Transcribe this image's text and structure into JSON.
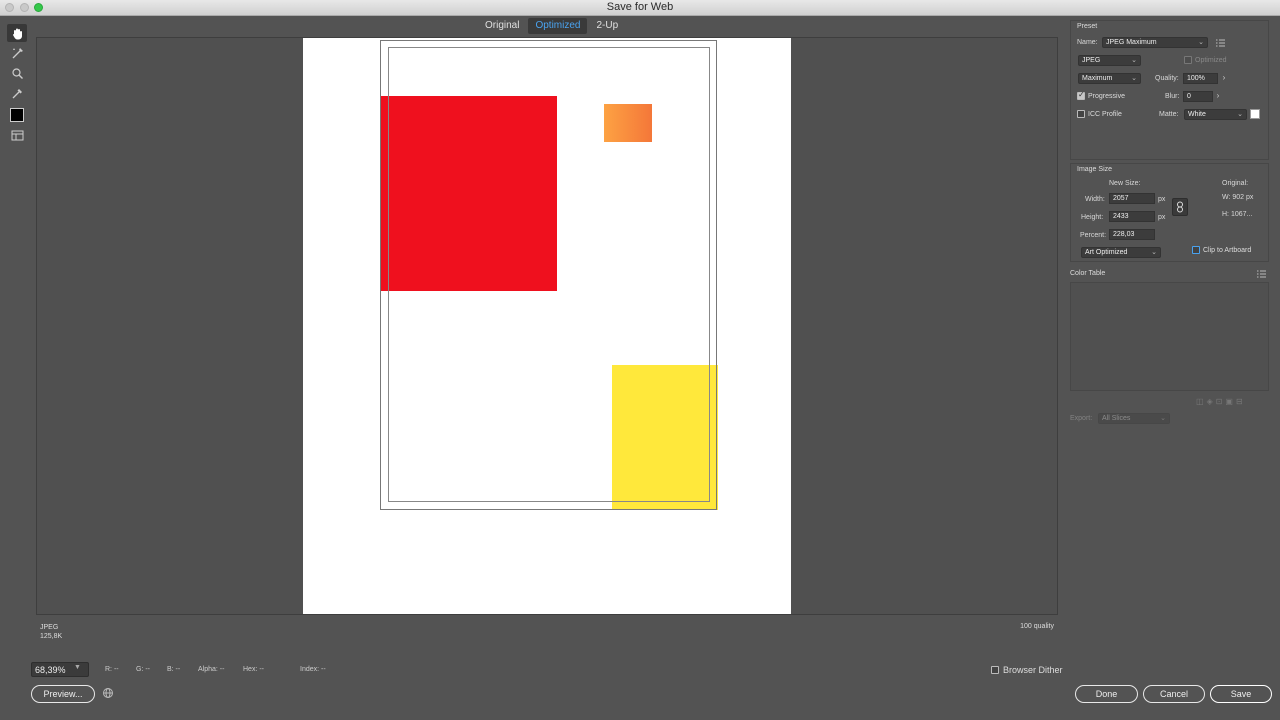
{
  "window": {
    "title": "Save for Web"
  },
  "view_tabs": [
    {
      "label": "Original",
      "active": false
    },
    {
      "label": "Optimized",
      "active": true
    },
    {
      "label": "2-Up",
      "active": false
    }
  ],
  "tools": [
    "hand-tool-icon",
    "slice-select-tool-icon",
    "zoom-tool-icon",
    "eyedropper-tool-icon",
    "eyedropper-color-swatch",
    "toggle-slices-icon"
  ],
  "canvas": {
    "shapes": [
      {
        "name": "red-rectangle",
        "color": "#ef101e"
      },
      {
        "name": "orange-rectangle",
        "color": "#f88a3e"
      },
      {
        "name": "yellow-rectangle",
        "color": "#ffe83b"
      }
    ]
  },
  "info": {
    "format": "JPEG",
    "size": "125,8K",
    "quality": "100 quality"
  },
  "status": {
    "zoom": "68,39%",
    "r": "R: --",
    "g": "G: --",
    "b": "B: --",
    "alpha": "Alpha: --",
    "hex": "Hex: --",
    "index": "Index: --",
    "browser_dither": "Browser Dither"
  },
  "buttons": {
    "preview": "Preview...",
    "done": "Done",
    "cancel": "Cancel",
    "save": "Save"
  },
  "preset": {
    "section_title": "Preset",
    "name_label": "Name:",
    "name_value": "JPEG Maximum",
    "format": "JPEG",
    "optimized": "Optimized",
    "quality_preset": "Maximum",
    "quality_label": "Quality:",
    "quality_value": "100%",
    "progressive": "Progressive",
    "progressive_checked": true,
    "blur_label": "Blur:",
    "blur_value": "0",
    "icc_profile": "ICC Profile",
    "icc_checked": false,
    "matte_label": "Matte:",
    "matte_value": "White",
    "matte_color": "#ffffff"
  },
  "image_size": {
    "section_title": "Image Size",
    "new_size_label": "New Size:",
    "width_label": "Width:",
    "width_value": "2057",
    "height_label": "Height:",
    "height_value": "2433",
    "unit": "px",
    "percent_label": "Percent:",
    "percent_value": "228,03",
    "original_label": "Original:",
    "original_w": "W:  902 px",
    "original_h": "H:  1067...",
    "resample": "Art Optimized",
    "clip_to_artboard": "Clip to Artboard"
  },
  "color_table": {
    "section_title": "Color Table",
    "export_label": "Export:",
    "export_value": "All Slices"
  }
}
